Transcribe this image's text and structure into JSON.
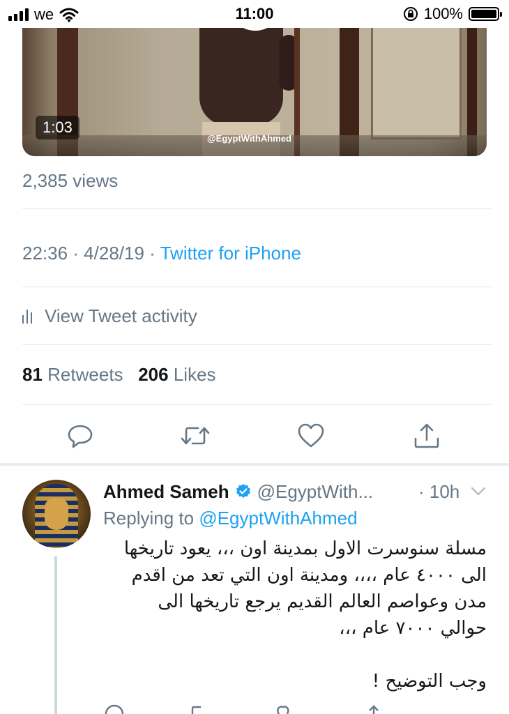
{
  "status_bar": {
    "carrier": "we",
    "time": "11:00",
    "battery": "100%"
  },
  "video": {
    "duration": "1:03",
    "watermark": "@EgyptWithAhmed"
  },
  "tweet": {
    "views": "2,385 views",
    "time": "22:36 · 4/28/19",
    "separator": "·",
    "source": "Twitter for iPhone",
    "activity_label": "View Tweet activity",
    "retweets_count": "81",
    "retweets_label": "Retweets",
    "likes_count": "206",
    "likes_label": "Likes"
  },
  "actions": {
    "reply_icon": "reply-icon",
    "retweet_icon": "retweet-icon",
    "like_icon": "heart-icon",
    "share_icon": "share-icon"
  },
  "reply": {
    "name": "Ahmed Sameh",
    "handle": "@EgyptWith...",
    "time": "· 10h",
    "replying_prefix": "Replying to",
    "replying_to": "@EgyptWithAhmed",
    "lines": [
      "مسلة سنوسرت الاول بمدينة اون ،،، يعود تاريخها",
      "الى ٤٠٠٠ عام ،،،،    ومدينة اون التي تعد من اقدم",
      "مدن وعواصم العالم القديم يرجع تاريخها الى",
      "حوالي ٧٠٠٠ عام ،،،"
    ],
    "last_line": "وجب التوضيح  !"
  },
  "colors": {
    "accent": "#1da1f2",
    "secondary_text": "#657786",
    "divider": "#e1e8ed"
  }
}
